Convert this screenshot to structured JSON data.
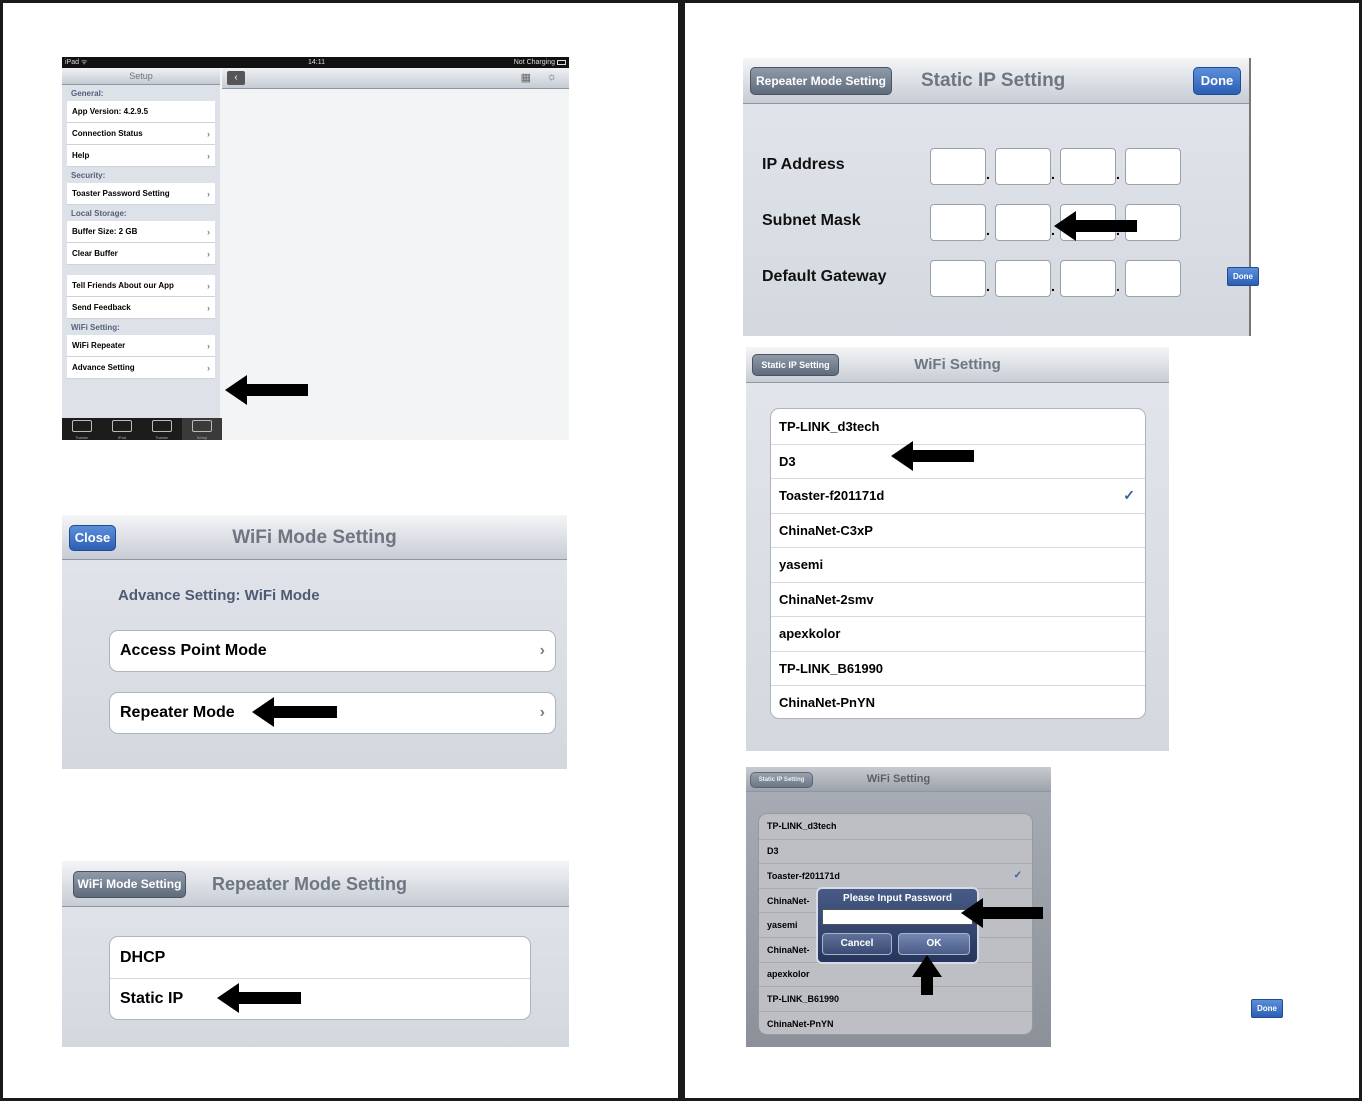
{
  "shot1": {
    "status": {
      "left": "iPad ᯤ",
      "time": "14:11",
      "right": "Not Charging"
    },
    "sidebar_title": "Setup",
    "sections": [
      {
        "header": "General:",
        "rows": [
          {
            "label": "App Version: 4.2.9.5",
            "chev": false
          },
          {
            "label": "Connection Status",
            "chev": true
          },
          {
            "label": "Help",
            "chev": true
          }
        ]
      },
      {
        "header": "Security:",
        "rows": [
          {
            "label": "Toaster Password Setting",
            "chev": true
          }
        ]
      },
      {
        "header": "Local Storage:",
        "rows": [
          {
            "label": "Buffer Size: 2 GB",
            "chev": true
          },
          {
            "label": "Clear Buffer",
            "chev": true
          }
        ]
      },
      {
        "header": "",
        "rows": [
          {
            "label": "Tell Friends About our App",
            "chev": true
          },
          {
            "label": "Send Feedback",
            "chev": true
          }
        ]
      },
      {
        "header": "WiFi Setting:",
        "rows": [
          {
            "label": "WiFi Repeater",
            "chev": true
          },
          {
            "label": "Advance Setting",
            "chev": true
          }
        ]
      }
    ],
    "tabs": [
      "Toaster",
      "iPad",
      "Toaster",
      "Setup"
    ]
  },
  "shot2": {
    "close": "Close",
    "title": "WiFi Mode Setting",
    "subtitle": "Advance Setting: WiFi Mode",
    "rows": [
      "Access Point Mode",
      "Repeater Mode"
    ]
  },
  "shot3": {
    "back": "WiFi Mode Setting",
    "title": "Repeater Mode Setting",
    "rows": [
      "DHCP",
      "Static IP"
    ]
  },
  "shot4": {
    "back": "Repeater Mode Setting",
    "title": "Static IP Setting",
    "done": "Done",
    "fields": [
      "IP Address",
      "Subnet Mask",
      "Default Gateway"
    ],
    "done_small": "Done"
  },
  "shot5": {
    "back": "Static IP Setting",
    "title": "WiFi Setting",
    "networks": [
      "TP-LINK_d3tech",
      "D3",
      "Toaster-f201171d",
      "ChinaNet-C3xP",
      "yasemi",
      "ChinaNet-2smv",
      "apexkolor",
      "TP-LINK_B61990",
      "ChinaNet-PnYN"
    ],
    "checked_index": 2,
    "check": "✓"
  },
  "shot6": {
    "back": "Static IP Setting",
    "title": "WiFi Setting",
    "networks": [
      "TP-LINK_d3tech",
      "D3",
      "Toaster-f201171d",
      "ChinaNet-",
      "yasemi",
      "ChinaNet-",
      "apexkolor",
      "TP-LINK_B61990",
      "ChinaNet-PnYN"
    ],
    "dialog_title": "Please Input Password",
    "cancel": "Cancel",
    "ok": "OK",
    "done_small": "Done"
  }
}
